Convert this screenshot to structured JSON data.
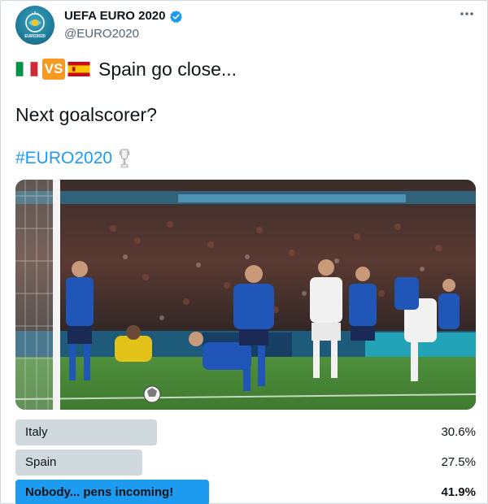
{
  "account": {
    "display_name": "UEFA EURO 2020",
    "handle": "@EURO2020",
    "avatar_icon": "euro2020-logo-icon",
    "verified_icon": "verified-badge-icon",
    "more_icon": "more-options-icon",
    "avatar_label": "EURO2020"
  },
  "tweet": {
    "flag_left": "italy-flag",
    "vs_label": "VS",
    "flag_right": "spain-flag",
    "line1": "Spain go close...",
    "line2": "Next goalscorer?",
    "hashtag": "#EURO2020",
    "hashtag_icon": "trophy-icon"
  },
  "media": {
    "description_icon": "football-match-photo"
  },
  "poll": {
    "options": [
      {
        "label": "Italy",
        "percent_text": "30.6%",
        "percent": 30.6,
        "winner": false
      },
      {
        "label": "Spain",
        "percent_text": "27.5%",
        "percent": 27.5,
        "winner": false
      },
      {
        "label": "Nobody... pens incoming!",
        "percent_text": "41.9%",
        "percent": 41.9,
        "winner": true
      }
    ]
  },
  "colors": {
    "accent": "#1d9bf0",
    "poll_bar": "#cfd9de",
    "vs_badge": "#f59a23",
    "italy_kit": "#1f56b8"
  }
}
